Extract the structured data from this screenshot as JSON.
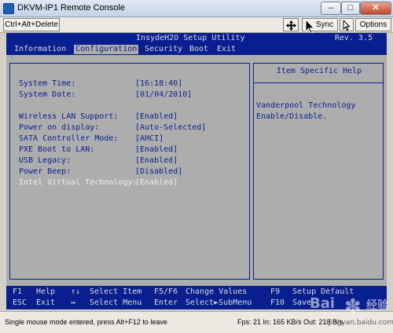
{
  "window": {
    "title": "DKVM-IP1 Remote Console",
    "minimize_glyph": "–",
    "maximize_glyph": "□",
    "close_glyph": "✕"
  },
  "toolbar": {
    "ctrl_alt_delete_label": "Ctrl+Alt+Delete",
    "move_icon": "move-icon",
    "sync_label": "Sync",
    "cursor_icon": "cursor-icon",
    "options_label": "Options"
  },
  "bios": {
    "name": "InsydeH2O Setup Utility",
    "revision": "Rev. 3.5",
    "tabs": [
      {
        "label": "Information"
      },
      {
        "label": "Configuration"
      },
      {
        "label": "Security"
      },
      {
        "label": "Boot"
      },
      {
        "label": "Exit"
      }
    ],
    "active_tab": "Configuration",
    "settings": [
      {
        "label": "System Time:",
        "value": "[16:18:40]"
      },
      {
        "label": "System Date:",
        "value": "[01/04/2010]"
      },
      {
        "label": "Wireless LAN Support:",
        "value": "[Enabled]"
      },
      {
        "label": "Power on display:",
        "value": "[Auto-Selected]"
      },
      {
        "label": "SATA Controller Mode:",
        "value": "[AHCI]"
      },
      {
        "label": "PXE Boot to LAN:",
        "value": "[Enabled]"
      },
      {
        "label": "USB Legacy:",
        "value": "[Enabled]"
      },
      {
        "label": "Power Beep:",
        "value": "[Disabled]"
      },
      {
        "label": "Intel Virtual Technology:",
        "value": "[Enabled]"
      }
    ],
    "highlighted_setting": "Intel Virtual Technology:",
    "help": {
      "title": "Item Specific Help",
      "lines": [
        "Vanderpool Technology",
        "Enable/Disable."
      ]
    },
    "footer": {
      "row1": [
        {
          "key": "F1",
          "action": "Help"
        },
        {
          "key": "↑↓",
          "action": "Select Item"
        },
        {
          "key": "F5/F6",
          "action": "Change Values"
        },
        {
          "key": "F9",
          "action": "Setup Default"
        }
      ],
      "row2": [
        {
          "key": "ESC",
          "action": "Exit"
        },
        {
          "key": "↔",
          "action": "Select Menu"
        },
        {
          "key": "Enter",
          "action": "Select►SubMenu"
        },
        {
          "key": "F10",
          "action": "Save"
        }
      ]
    },
    "colors": {
      "background": "#adadad",
      "bar": "#0a1f8f",
      "bar_text": "#d8d8d8",
      "highlight_text": "#f0f0f0"
    }
  },
  "status": {
    "message": "Single mouse mode entered, press Alt+F12 to leave",
    "stats": "Fps: 21 In: 165 KB/s Out: 218 B/s"
  },
  "watermark": {
    "text": "Bai",
    "sub": "经验",
    "url": "jingyan.baidu.com"
  }
}
